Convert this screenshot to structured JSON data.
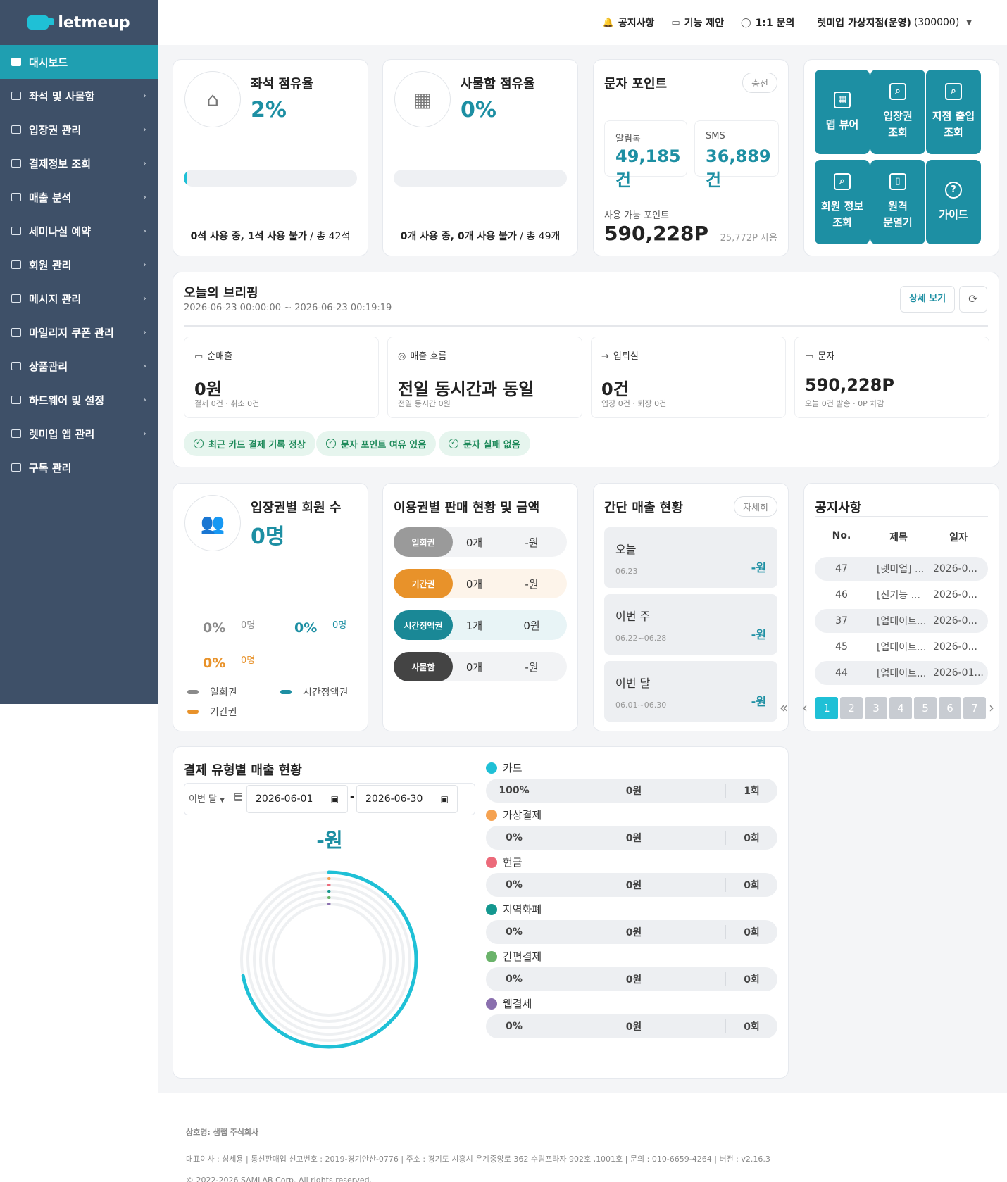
{
  "brand": {
    "name": "letmeup"
  },
  "sidebar": {
    "items": [
      {
        "label": "대시보드",
        "active": true
      },
      {
        "label": "좌석 및 사물함"
      },
      {
        "label": "입장권 관리"
      },
      {
        "label": "결제정보 조회"
      },
      {
        "label": "매출 분석"
      },
      {
        "label": "세미나실 예약"
      },
      {
        "label": "회원 관리"
      },
      {
        "label": "메시지 관리"
      },
      {
        "label": "마일리지 쿠폰 관리"
      },
      {
        "label": "상품관리"
      },
      {
        "label": "하드웨어 및 설정"
      },
      {
        "label": "렛미업 앱 관리"
      },
      {
        "label": "구독 관리"
      }
    ]
  },
  "topbar": {
    "notice": "공지사항",
    "suggest": "기능 제안",
    "inquiry": "1:1 문의",
    "store_name": "렛미업 가상지점(운영)",
    "store_code": "(300000)"
  },
  "seat": {
    "title": "좌석 점유율",
    "pct": "2%",
    "fill": 0.02,
    "in_use": "0석 사용 중, 1석 사용 불가",
    "total": " / 총 42석"
  },
  "locker": {
    "title": "사물함 점유율",
    "pct": "0%",
    "fill": 0,
    "in_use": "0개 사용 중, 0개 사용 불가",
    "total": " / 총 49개"
  },
  "sms": {
    "title": "문자 포인트",
    "charge": "충전",
    "alimtalk_label": "알림톡",
    "alimtalk_value": "49,185건",
    "sms_label": "SMS",
    "sms_value": "36,889건",
    "avail_label": "사용 가능 포인트",
    "avail_value": "590,228P",
    "used": "25,772P 사용"
  },
  "quick": [
    {
      "label1": "맵 뷰어",
      "label2": ""
    },
    {
      "label1": "입장권",
      "label2": "조회"
    },
    {
      "label1": "지점 출입",
      "label2": "조회"
    },
    {
      "label1": "회원 정보",
      "label2": "조회"
    },
    {
      "label1": "원격",
      "label2": "문열기"
    },
    {
      "label1": "가이드",
      "label2": ""
    }
  ],
  "briefing": {
    "title": "오늘의 브리핑",
    "range": "2026-06-23 00:00:00 ~ 2026-06-23 00:19:19",
    "detail": "상세 보기",
    "boxes": [
      {
        "label": "순매출",
        "value": "0원",
        "sub": "결제 0건 · 취소 0건"
      },
      {
        "label": "매출 흐름",
        "value": "전일 동시간과 동일",
        "sub": "전일 동시간 0원"
      },
      {
        "label": "입퇴실",
        "value": "0건",
        "sub": "입장 0건 · 퇴장 0건"
      },
      {
        "label": "문자",
        "value": "590,228P",
        "sub": "오늘 0건 발송 · 0P 차감"
      }
    ],
    "chips": [
      "최근 카드 결제 기록 정상",
      "문자 포인트 여유 있음",
      "문자 실패 없음"
    ]
  },
  "members": {
    "title": "입장권별 회원 수",
    "total": "0명",
    "stats": [
      {
        "pct": "0%",
        "count": "0명",
        "color": "#8a8a8a"
      },
      {
        "pct": "0%",
        "count": "0명",
        "color": "#1d8fa3"
      },
      {
        "pct": "0%",
        "count": "0명",
        "color": "#e8922a"
      }
    ],
    "legend": [
      {
        "label": "일회권",
        "color": "#8a8a8a"
      },
      {
        "label": "시간정액권",
        "color": "#1d8fa3"
      },
      {
        "label": "기간권",
        "color": "#e8922a"
      }
    ]
  },
  "passes": {
    "title": "이용권별 판매 현황 및 금액",
    "rows": [
      {
        "tag": "일회권",
        "count": "0개",
        "amount": "-원",
        "color": "#9a9a9a",
        "bg": "#f2f3f5"
      },
      {
        "tag": "기간권",
        "count": "0개",
        "amount": "-원",
        "color": "#e8922a",
        "bg": "#fdf4ea"
      },
      {
        "tag": "시간정액권",
        "count": "1개",
        "amount": "0원",
        "color": "#1a8896",
        "bg": "#e8f4f6"
      },
      {
        "tag": "사물함",
        "count": "0개",
        "amount": "-원",
        "color": "#444444",
        "bg": "#f2f3f5"
      }
    ]
  },
  "sales": {
    "title": "간단 매출 현황",
    "more": "자세히",
    "rows": [
      {
        "label": "오늘",
        "date": "06.23",
        "value": "-원"
      },
      {
        "label": "이번 주",
        "date": "06.22~06.28",
        "value": "-원"
      },
      {
        "label": "이번 달",
        "date": "06.01~06.30",
        "value": "-원"
      }
    ]
  },
  "notices": {
    "title": "공지사항",
    "headers": [
      "No.",
      "제목",
      "일자"
    ],
    "rows": [
      {
        "no": "47",
        "title": "[렛미업] ...",
        "date": "2026-0..."
      },
      {
        "no": "46",
        "title": "[신기능 ...",
        "date": "2026-0..."
      },
      {
        "no": "37",
        "title": "[업데이트...",
        "date": "2026-0..."
      },
      {
        "no": "45",
        "title": "[업데이트...",
        "date": "2026-0..."
      },
      {
        "no": "44",
        "title": "[업데이트...",
        "date": "2026-01..."
      }
    ],
    "pages": [
      "1",
      "2",
      "3",
      "4",
      "5",
      "6",
      "7"
    ]
  },
  "payment": {
    "title": "결제 유형별 매출 현황",
    "period": "이번 달",
    "start": "2026-06-01",
    "end": "2026-06-30",
    "dash": "-",
    "total": "-원",
    "types": [
      {
        "name": "카드",
        "pct": "100%",
        "amount": "0원",
        "count": "1회",
        "color": "#1fc0d6"
      },
      {
        "name": "가상결제",
        "pct": "0%",
        "amount": "0원",
        "count": "0회",
        "color": "#f5a251"
      },
      {
        "name": "현금",
        "pct": "0%",
        "amount": "0원",
        "count": "0회",
        "color": "#ec6a7a"
      },
      {
        "name": "지역화폐",
        "pct": "0%",
        "amount": "0원",
        "count": "0회",
        "color": "#13978f"
      },
      {
        "name": "간편결제",
        "pct": "0%",
        "amount": "0원",
        "count": "0회",
        "color": "#6ab36a"
      },
      {
        "name": "웹결제",
        "pct": "0%",
        "amount": "0원",
        "count": "0회",
        "color": "#8a6fae"
      }
    ]
  },
  "footer": {
    "company": "상호명: 샘랩 주식회사",
    "info": "대표이사 : 심세용  |  통신판매업 신고번호 : 2019-경기안산-0776  |  주소 : 경기도 시흥시 은계중앙로 362 수림프라자 902호 ,1001호  |  문의 : 010-6659-4264  |  버전 : v2.16.3",
    "copyright": "© 2022-2026 SAMLAB Corp. All rights reserved."
  }
}
